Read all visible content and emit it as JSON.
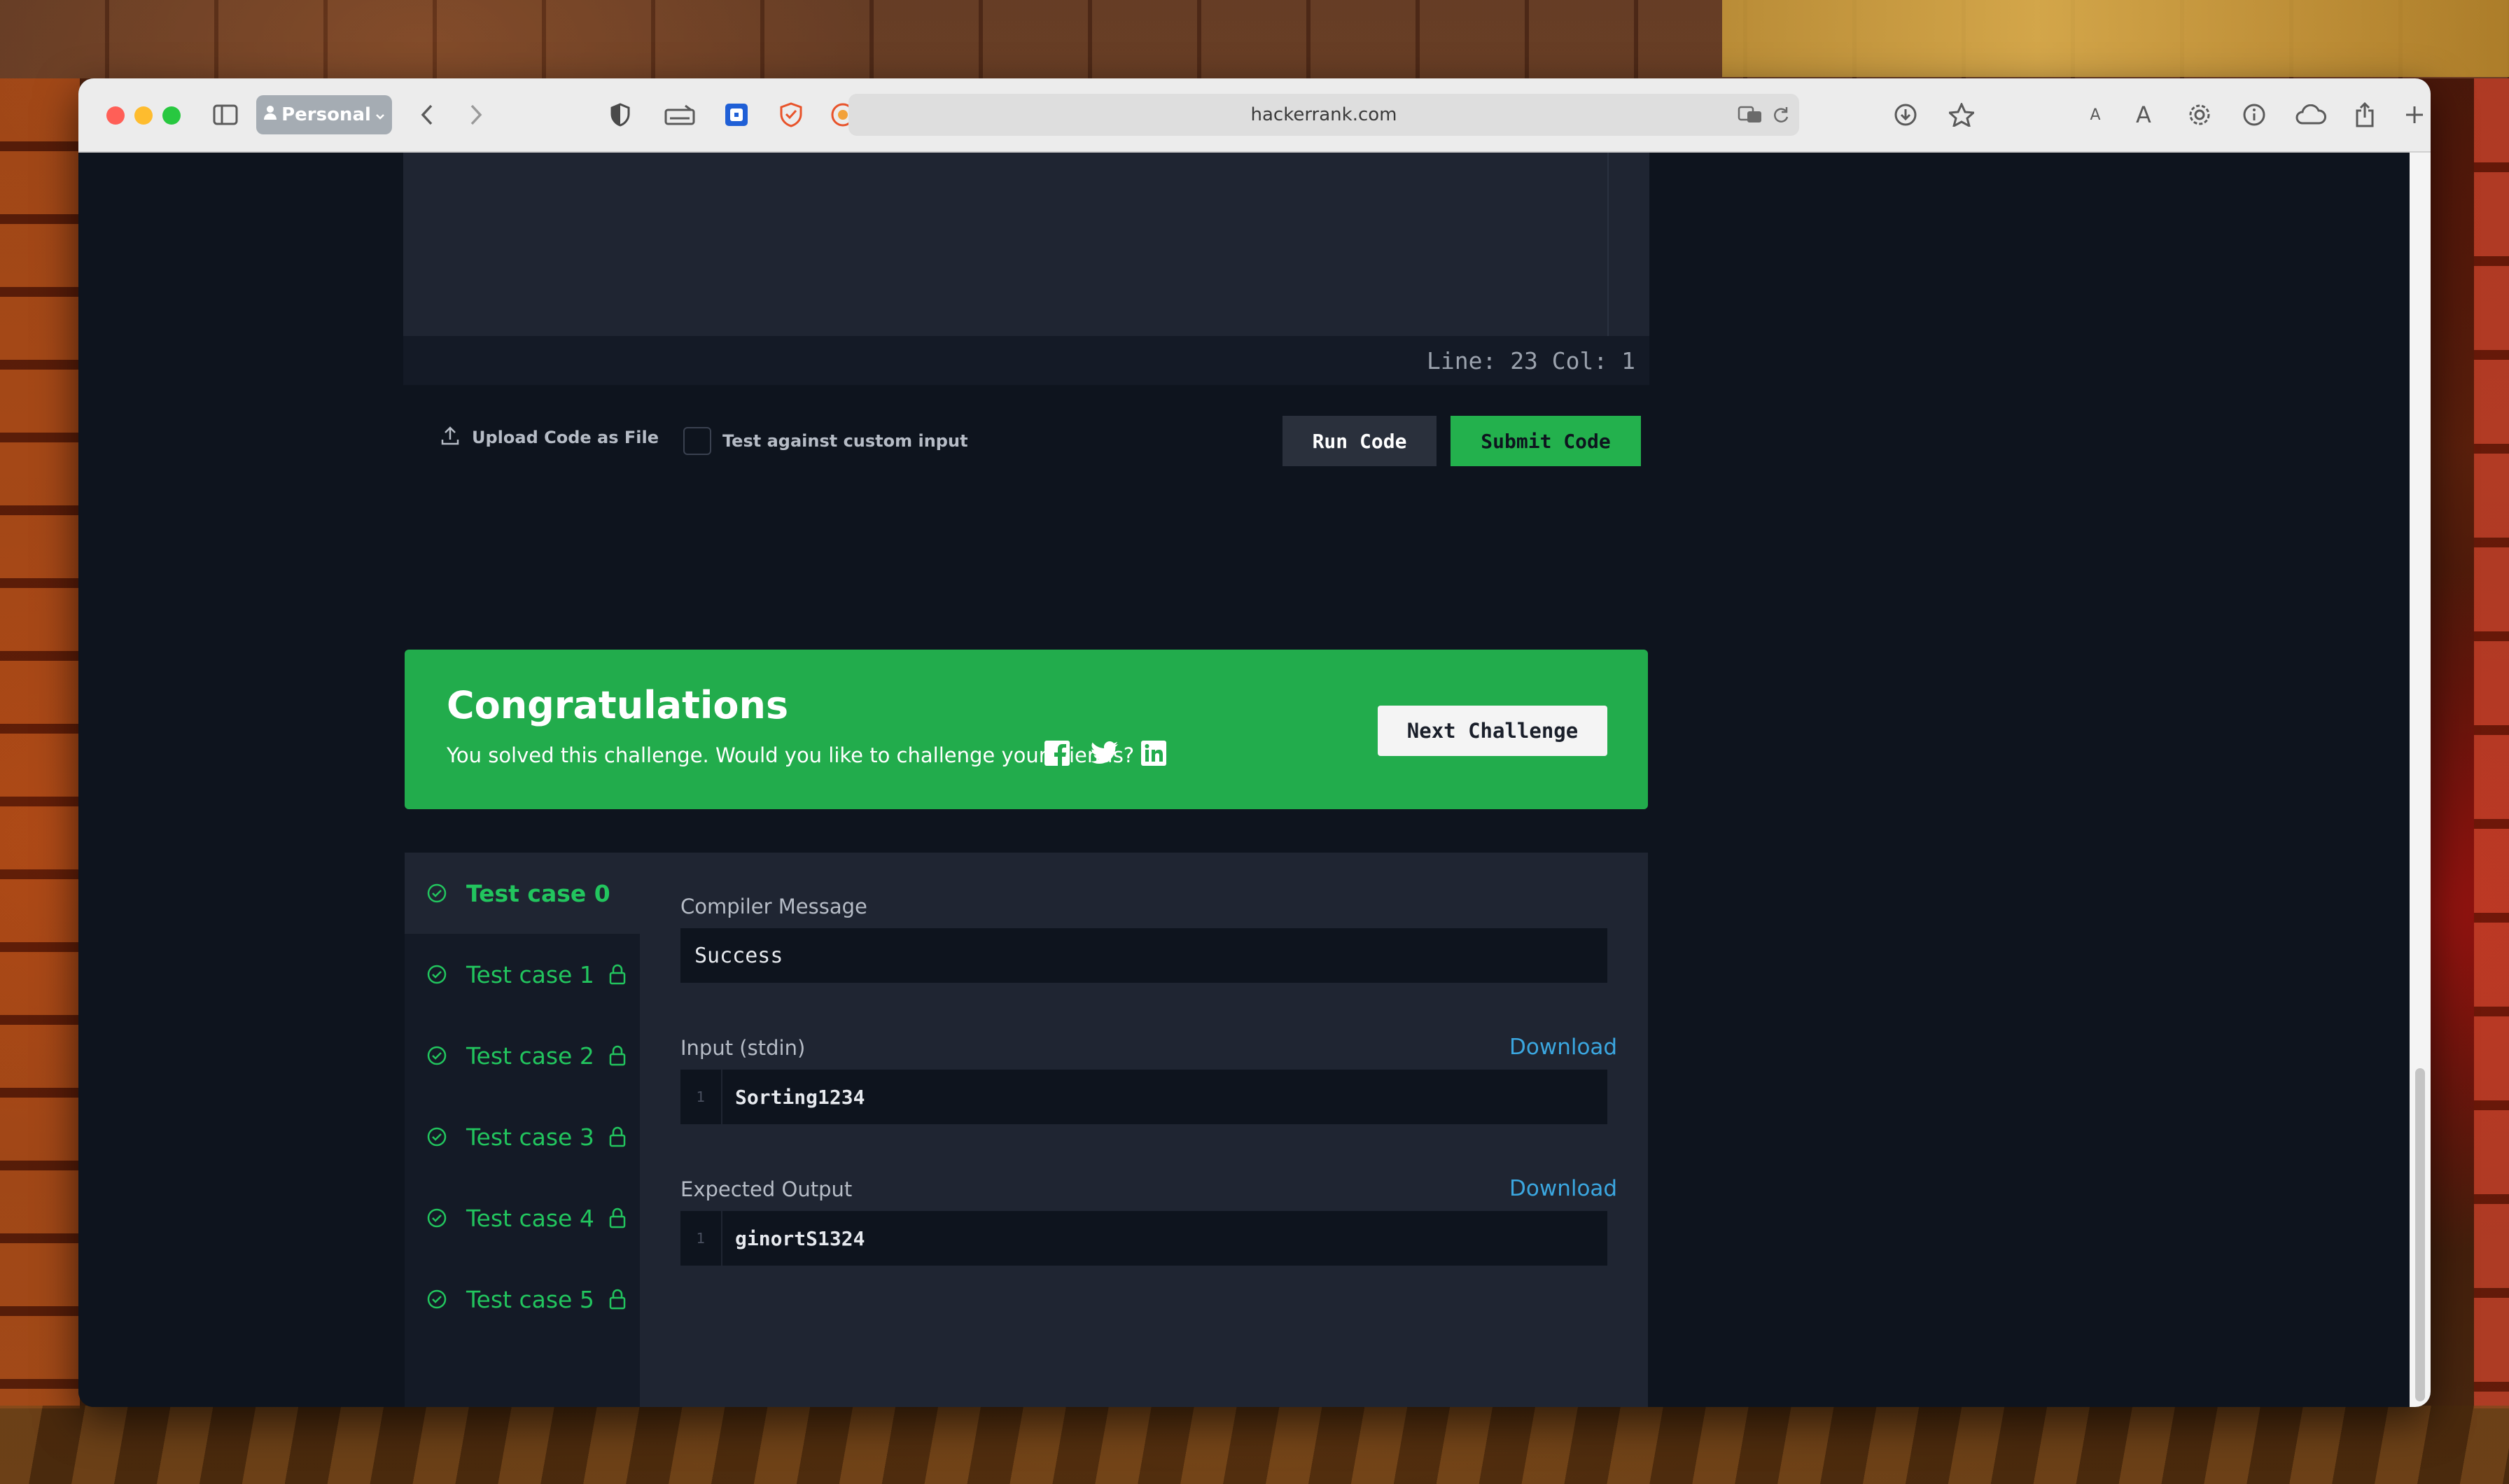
{
  "browser": {
    "profile_label": "Personal",
    "url": "hackerrank.com"
  },
  "editor": {
    "status": "Line: 23 Col: 1"
  },
  "actions": {
    "upload_label": "Upload Code as File",
    "custom_input_label": "Test against custom input",
    "run_label": "Run Code",
    "submit_label": "Submit Code"
  },
  "congrats": {
    "title": "Congratulations",
    "message": "You solved this challenge. Would you like to challenge your friends?",
    "next_label": "Next Challenge"
  },
  "test_cases": [
    {
      "label": "Test case 0",
      "active": true,
      "locked": false
    },
    {
      "label": "Test case 1",
      "active": false,
      "locked": true
    },
    {
      "label": "Test case 2",
      "active": false,
      "locked": true
    },
    {
      "label": "Test case 3",
      "active": false,
      "locked": true
    },
    {
      "label": "Test case 4",
      "active": false,
      "locked": true
    },
    {
      "label": "Test case 5",
      "active": false,
      "locked": true
    }
  ],
  "results": {
    "compiler_label": "Compiler Message",
    "compiler_message": "Success",
    "input_label": "Input (stdin)",
    "input_line_no": "1",
    "input_value": "Sorting1234",
    "expected_label": "Expected Output",
    "expected_line_no": "1",
    "expected_value": "ginortS1324",
    "download_label": "Download"
  },
  "colors": {
    "accent_green": "#22ac4c",
    "pass_green": "#22c55e",
    "link_blue": "#3ba7e0",
    "page_bg": "#0e141e"
  }
}
